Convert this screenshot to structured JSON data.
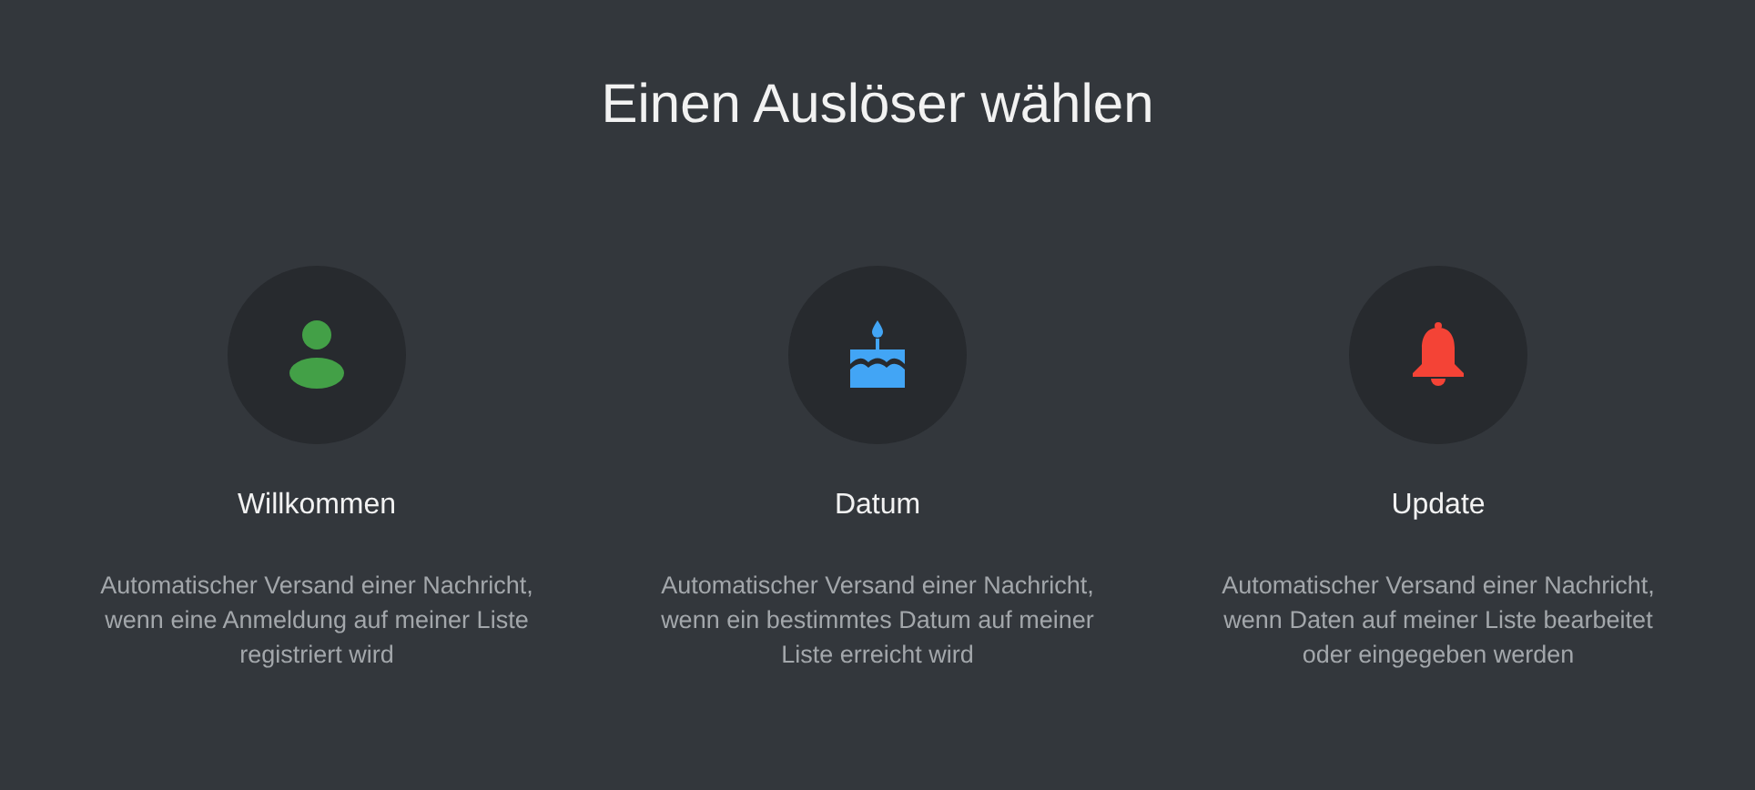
{
  "title": "Einen Auslöser wählen",
  "triggers": [
    {
      "kind": "person",
      "color": "#43a047",
      "label": "Willkommen",
      "description": "Automatischer Versand einer Nachricht, wenn eine Anmeldung auf meiner Liste registriert wird"
    },
    {
      "kind": "cake",
      "color": "#42a5f5",
      "label": "Datum",
      "description": "Automatischer Versand einer Nachricht, wenn ein bestimmtes Datum auf meiner Liste erreicht wird"
    },
    {
      "kind": "bell",
      "color": "#f44336",
      "label": "Update",
      "description": "Automatischer Versand einer Nachricht, wenn Daten auf meiner Liste bearbeitet oder eingegeben werden"
    }
  ]
}
